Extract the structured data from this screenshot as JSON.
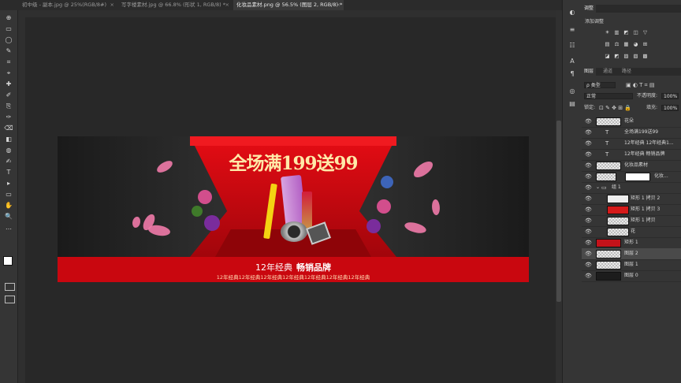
{
  "tabs": [
    {
      "label": "初中级 - 副本.jpg @ 25%(RGB/8#)",
      "active": false
    },
    {
      "label": "写字楼素材.jpg @ 66.8% (形状 1, RGB/8) *",
      "active": false
    },
    {
      "label": "化妆品素材.png @ 56.5% (图层 2, RGB/8) *",
      "active": true
    }
  ],
  "tab_close": "×",
  "tools": [
    "⊕",
    "▭",
    "◯",
    "✎",
    "⌗",
    "⌖",
    "✚",
    "✐",
    "⎘",
    "✑",
    "⌫",
    "◧",
    "◍",
    "✍",
    "T",
    "▸",
    "▭",
    "✋",
    "🔍",
    "…"
  ],
  "strip_icons": [
    "◐",
    "≡",
    "☷",
    "A",
    "¶",
    "◎",
    "▤"
  ],
  "adjust_panel": {
    "title": "调整",
    "subtitle": "添加调整",
    "icons_row1": [
      "☀",
      "▥",
      "◩",
      "◫",
      "▽"
    ],
    "icons_row2": [
      "▤",
      "⚖",
      "▦",
      "◕",
      "⊞"
    ],
    "icons_row3": [
      "◪",
      "◩",
      "▨",
      "▧",
      "▩"
    ]
  },
  "layers_panel": {
    "tabs": [
      "图层",
      "通道",
      "路径"
    ],
    "kind_label": "ρ 类型",
    "blend_mode": "正常",
    "opacity_label": "不透明度:",
    "opacity_value": "100%",
    "lock_label": "锁定:",
    "fill_label": "填充:",
    "fill_value": "100%",
    "layers": [
      {
        "name": "花朵",
        "type": "image",
        "selected": false
      },
      {
        "name": "全场满199送99",
        "type": "text",
        "selected": false
      },
      {
        "name": "12年经典 12年经典1...",
        "type": "text",
        "selected": false
      },
      {
        "name": "12年经典  畅销品牌",
        "type": "text",
        "selected": false
      },
      {
        "name": "化妆品素材",
        "type": "image",
        "selected": false
      },
      {
        "name": "化妆...",
        "type": "mask",
        "selected": false
      },
      {
        "name": "组 1",
        "type": "group",
        "selected": false
      },
      {
        "name": "矩形 1 拷贝 2",
        "type": "shape",
        "selected": false
      },
      {
        "name": "矩形 1 拷贝 3",
        "type": "shape",
        "selected": false
      },
      {
        "name": "矩形 1 拷贝",
        "type": "shape",
        "selected": false
      },
      {
        "name": "花",
        "type": "image",
        "selected": false
      },
      {
        "name": "矩形 1",
        "type": "shape",
        "selected": false
      },
      {
        "name": "图层 2",
        "type": "image",
        "selected": true
      },
      {
        "name": "图层 1",
        "type": "image",
        "selected": false
      },
      {
        "name": "图层 0",
        "type": "image",
        "selected": false
      }
    ]
  },
  "banner": {
    "headline": "全场满199送99",
    "sub_left": "12年经典",
    "sub_right": "畅销品牌",
    "repeat_line": "12年经典12年经典12年经典12年经典12年经典12年经典12年经典"
  }
}
